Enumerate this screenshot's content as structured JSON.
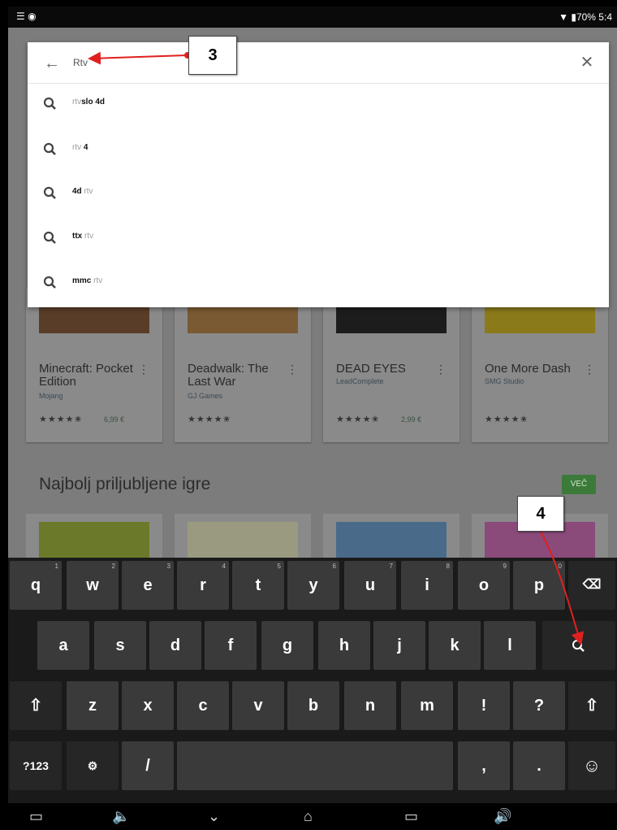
{
  "status_bar": {
    "left_icons": "☰ ◉",
    "right_text": "▼ ▮70% 5:4"
  },
  "search": {
    "query": "Rtv",
    "suggestions": [
      {
        "light": "rtv",
        "bold": "slo 4d",
        "order": "light-first"
      },
      {
        "light": "rtv",
        "bold": "4",
        "order": "light-first"
      },
      {
        "bold": "4d",
        "light": "rtv",
        "order": "bold-first"
      },
      {
        "bold": "ttx",
        "light": "rtv",
        "order": "bold-first"
      },
      {
        "bold": "mmc",
        "light": "rtv",
        "order": "bold-first"
      }
    ]
  },
  "apps_row": [
    {
      "title": "Minecraft: Pocket Edition",
      "developer": "Mojang",
      "stars": "★★★★✬",
      "price": "6,99 €",
      "art": "#5a3d28"
    },
    {
      "title": "Deadwalk: The Last War",
      "developer": "GJ Games",
      "stars": "★★★★✬",
      "price": "",
      "art": "#7a5a33"
    },
    {
      "title": "DEAD EYES",
      "developer": "LeadComplete",
      "stars": "★★★★✬",
      "price": "2,99 €",
      "art": "#1c1c1c"
    },
    {
      "title": "One More Dash",
      "developer": "SMG Studio",
      "stars": "★★★★✬",
      "price": "",
      "art": "#8a7a1a"
    }
  ],
  "section": {
    "title": "Najbolj priljubljene igre",
    "more_label": "VEČ"
  },
  "annotations": {
    "callout_3": "3",
    "callout_4": "4",
    "arrow_color": "#e02020"
  },
  "keyboard": {
    "row1": [
      {
        "k": "q",
        "h": "1"
      },
      {
        "k": "w",
        "h": "2"
      },
      {
        "k": "e",
        "h": "3"
      },
      {
        "k": "r",
        "h": "4"
      },
      {
        "k": "t",
        "h": "5"
      },
      {
        "k": "y",
        "h": "6"
      },
      {
        "k": "u",
        "h": "7"
      },
      {
        "k": "i",
        "h": "8"
      },
      {
        "k": "o",
        "h": "9"
      },
      {
        "k": "p",
        "h": "0"
      }
    ],
    "row2": [
      "a",
      "s",
      "d",
      "f",
      "g",
      "h",
      "j",
      "k",
      "l"
    ],
    "row3": [
      "z",
      "x",
      "c",
      "v",
      "b",
      "n",
      "m",
      "!",
      "?"
    ],
    "symbols_label": "?123",
    "emoji_label": "☺",
    "slash_label": "/",
    "comma_label": ",",
    "period_label": ".",
    "backspace_label": "⌫",
    "shift_label": "⇧",
    "settings_label": "⚙"
  },
  "nav_bar": {
    "screenshot_icon": "▭",
    "vol_down": "🔈",
    "hide_kb": "⌄",
    "home": "⌂",
    "recents": "▭",
    "vol_up": "🔊"
  }
}
